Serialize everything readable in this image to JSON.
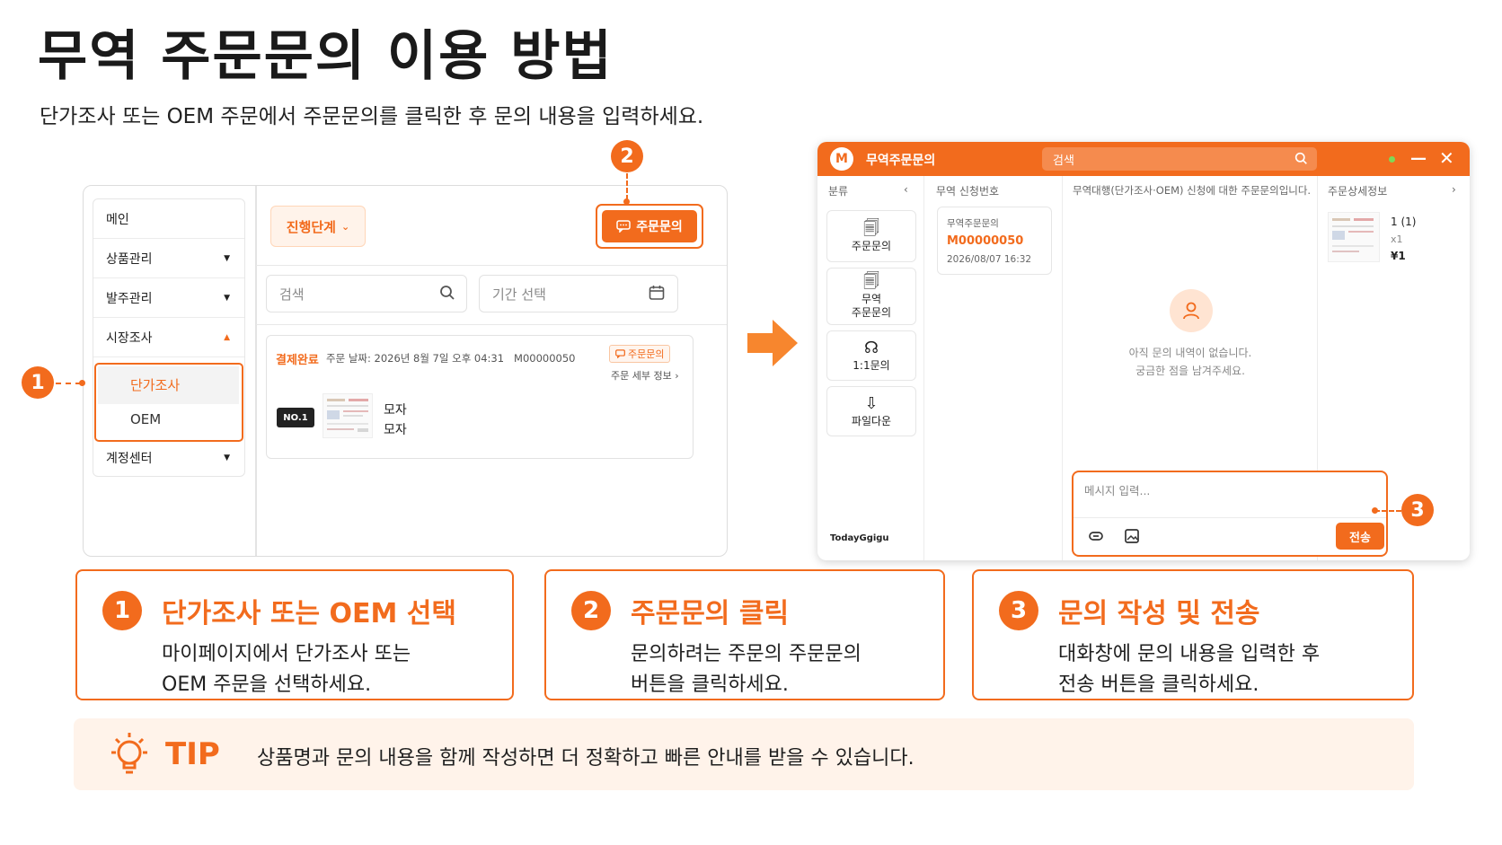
{
  "header": {
    "title": "무역 주문문의 이용 방법",
    "subtitle": "단가조사 또는 OEM 주문에서 주문문의를 클릭한 후 문의 내용을 입력하세요."
  },
  "left_panel": {
    "menu": [
      {
        "label": "메인"
      },
      {
        "label": "상품관리"
      },
      {
        "label": "발주관리"
      },
      {
        "label": "시장조사"
      },
      {
        "label": "계정센터"
      }
    ],
    "submenu": [
      {
        "label": "단가조사",
        "active": true
      },
      {
        "label": "OEM",
        "active": false
      }
    ],
    "stage_button": "진행단계",
    "inquiry_button": "주문문의",
    "search_placeholder": "검색",
    "date_placeholder": "기간 선택",
    "order": {
      "status": "결제완료",
      "date_line": "주문 날짜: 2026년 8월 7일 오후 04:31",
      "order_no": "M00000050",
      "inquiry_tag": "주문문의",
      "detail_link": "주문 세부 정보 ›",
      "rank_badge": "NO.1",
      "name1": "모자",
      "name2": "모자"
    }
  },
  "chat_window": {
    "logo": "M",
    "title": "무역주문문의",
    "search_placeholder": "검색",
    "columns": {
      "category": "분류",
      "request_no": "무역 신청번호",
      "conversation": "무역대행(단가조사·OEM) 신청에 대한 주문문의입니다.",
      "detail": "주문상세정보"
    },
    "categories": [
      {
        "icon": "receipt-icon",
        "label": "주문문의"
      },
      {
        "icon": "trade-receipt-icon",
        "label_line1": "무역",
        "label_line2": "주문문의"
      },
      {
        "icon": "headset-icon",
        "label": "1:1문의"
      },
      {
        "icon": "file-download-icon",
        "label": "파일다운"
      }
    ],
    "brand": "TodayGgigu",
    "request": {
      "label": "무역주문문의",
      "number": "M00000050",
      "datetime": "2026/08/07 16:32"
    },
    "empty_line1": "아직 문의 내역이 없습니다.",
    "empty_line2": "궁금한 점을 남겨주세요.",
    "message_placeholder": "메시지 입력...",
    "send_button": "전송",
    "detail": {
      "qty": "1 (1)",
      "multiplier": "x1",
      "price": "¥1"
    }
  },
  "badges": [
    "1",
    "2",
    "3"
  ],
  "steps": [
    {
      "number": "1",
      "title": "단가조사 또는 OEM 선택",
      "line1": "마이페이지에서 단가조사 또는",
      "line2": "OEM 주문을 선택하세요."
    },
    {
      "number": "2",
      "title": "주문문의 클릭",
      "line1": "문의하려는 주문의 주문문의",
      "line2": "버튼을 클릭하세요."
    },
    {
      "number": "3",
      "title": "문의 작성 및 전송",
      "line1": "대화창에 문의 내용을 입력한 후",
      "line2": "전송 버튼을 클릭하세요."
    }
  ],
  "tip": {
    "label": "TIP",
    "text": "상품명과 문의 내용을 함께 작성하면 더 정확하고 빠른 안내를 받을 수 있습니다."
  },
  "colors": {
    "accent": "#f26b1d",
    "accent_light": "#fff3ea",
    "text": "#1f1f1f"
  }
}
